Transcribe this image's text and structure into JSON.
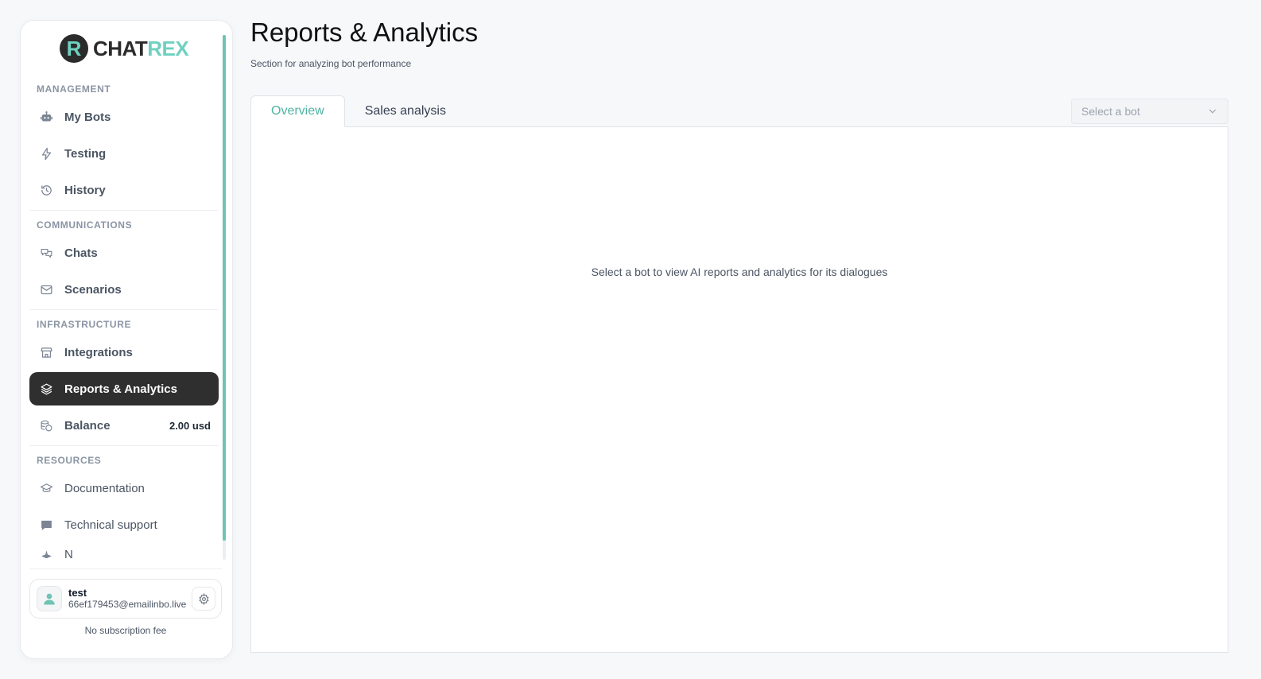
{
  "brand": {
    "mark": "R",
    "name_part1": "CHAT",
    "name_part2": "REX",
    "colors": {
      "dark": "#2b2b2b",
      "accent": "#6fd1bf"
    }
  },
  "sidebar": {
    "sections": {
      "management": "MANAGEMENT",
      "communications": "COMMUNICATIONS",
      "infrastructure": "INFRASTRUCTURE",
      "resources": "RESOURCES"
    },
    "items": {
      "my_bots": {
        "label": "My Bots",
        "icon": "robot-icon"
      },
      "testing": {
        "label": "Testing",
        "icon": "lightning-icon"
      },
      "history": {
        "label": "History",
        "icon": "history-icon"
      },
      "chats": {
        "label": "Chats",
        "icon": "chat-icon"
      },
      "scenarios": {
        "label": "Scenarios",
        "icon": "mail-icon"
      },
      "integrations": {
        "label": "Integrations",
        "icon": "store-icon"
      },
      "reports": {
        "label": "Reports & Analytics",
        "icon": "layers-icon",
        "active": true
      },
      "balance": {
        "label": "Balance",
        "icon": "coins-icon",
        "value": "2.00 usd"
      },
      "documentation": {
        "label": "Documentation",
        "icon": "graduation-cap-icon"
      },
      "support": {
        "label": "Technical support",
        "icon": "message-square-icon"
      },
      "news": {
        "label": "N",
        "icon": "sparkle-icon"
      }
    },
    "user": {
      "name": "test",
      "email": "66ef179453@emailinbo.live",
      "subscription": "No subscription fee"
    }
  },
  "main": {
    "title": "Reports & Analytics",
    "subtitle": "Section for analyzing bot performance",
    "tabs": [
      {
        "label": "Overview",
        "active": true
      },
      {
        "label": "Sales analysis",
        "active": false
      }
    ],
    "bot_select": {
      "placeholder": "Select a bot"
    },
    "empty_message": "Select a bot to view AI reports and analytics for its dialogues"
  },
  "colors": {
    "accent": "#4fb3a3",
    "active_nav": "#2f2f2f",
    "page_bg": "#f7f8fa"
  }
}
